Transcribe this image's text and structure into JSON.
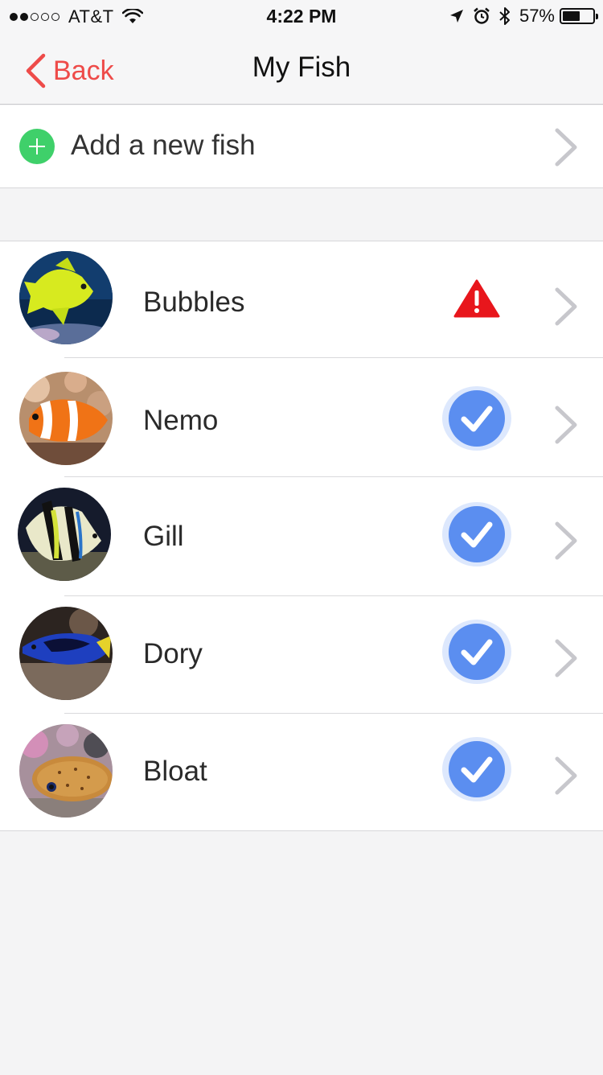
{
  "status_bar": {
    "carrier": "AT&T",
    "time": "4:22 PM",
    "battery_percent": "57%",
    "battery_level": 0.57,
    "signal_bars_filled": 2,
    "signal_bars_total": 5
  },
  "nav": {
    "back_label": "Back",
    "title": "My Fish"
  },
  "add_row": {
    "label": "Add a new fish"
  },
  "colors": {
    "accent_red": "#ee4b49",
    "add_green": "#3fd06a",
    "check_blue": "#5b8ef0",
    "warning_red": "#e8161c",
    "chevron_gray": "#c7c7cc"
  },
  "fish": [
    {
      "name": "Bubbles",
      "status": "warning",
      "status_icon": "warning-icon"
    },
    {
      "name": "Nemo",
      "status": "ok",
      "status_icon": "check-circle-icon"
    },
    {
      "name": "Gill",
      "status": "ok",
      "status_icon": "check-circle-icon"
    },
    {
      "name": "Dory",
      "status": "ok",
      "status_icon": "check-circle-icon"
    },
    {
      "name": "Bloat",
      "status": "ok",
      "status_icon": "check-circle-icon"
    }
  ]
}
